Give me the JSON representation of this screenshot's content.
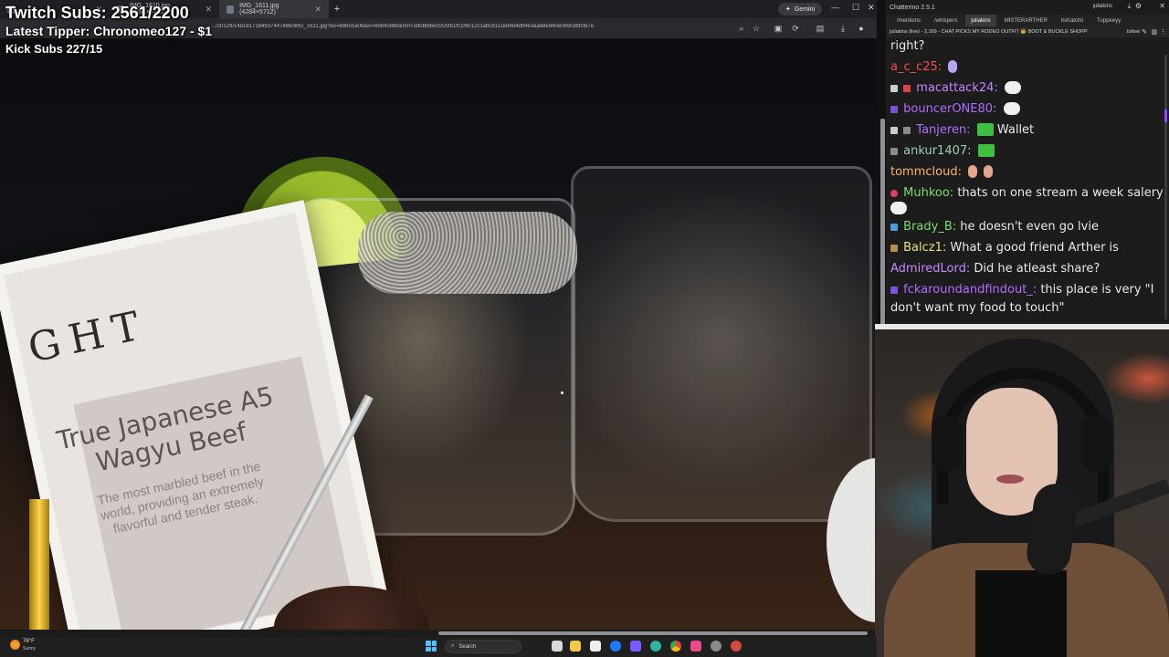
{
  "overlay": {
    "twitch_subs": "Twitch Subs: 2561/2200",
    "latest_tipper": "Latest Tipper: Chronomeo127 - $1",
    "kick_subs": "Kick Subs 227/15"
  },
  "browser": {
    "tabs": [
      {
        "label": "IMG_1610.jpg (4284×5712)",
        "active": false
      },
      {
        "label": "IMG_1611.jpg (4284×5712)",
        "active": true
      }
    ],
    "gemini_label": "Gemini",
    "url": "…/20129/1481817184937447486/IMG_1611.jpg?ex=69b55a0b&is=69b4088b&hm=3d0bfb6e0205fb1fc1f9012c1abc9111ed464dff4e3aab8e940e069cdbfcfb7e"
  },
  "photo": {
    "card_title": "GHT",
    "card_heading": "True Japanese A5 Wagyu Beef",
    "card_body": "The most marbled beef in the world, providing an extremely flavorful and tender steak."
  },
  "chat": {
    "app_title": "Chatterino 2.5.1",
    "user": "juliakins",
    "tabs": [
      "/mentions",
      "/whispers",
      "juliakins",
      "MISTERARTHER",
      "itsKatchii",
      "Tuppeeyy"
    ],
    "active_tab": "juliakins",
    "stream_header": "juliakins (live) - 2,169 - CHAT PICKS MY RODEO OUTFIT 🤠 BOOT & BUCKLE SHOPP",
    "follow_label": "follow",
    "messages": [
      {
        "user": "",
        "text": "right?",
        "color": "#e9e9e9"
      },
      {
        "user": "a_c_c25:",
        "text": "",
        "color": "#ff4a4a"
      },
      {
        "user": "macattack24:",
        "text": "",
        "color": "#c586ff"
      },
      {
        "user": "bouncerONE80:",
        "text": "",
        "color": "#b06cff"
      },
      {
        "user": "Tanjeren:",
        "text": "Wallet",
        "color": "#b06cff"
      },
      {
        "user": "ankur1407:",
        "text": "",
        "color": "#9ad0b0"
      },
      {
        "user": "tommcloud:",
        "text": "",
        "color": "#ffb26b"
      },
      {
        "user": "Muhkoo:",
        "text": "thats on one stream a week salery",
        "color": "#7cdb6f"
      },
      {
        "user": "Brady_B:",
        "text": "he doesn't even go lvie",
        "color": "#7cdb6f"
      },
      {
        "user": "Balcz1:",
        "text": "What a good friend Arther is",
        "color": "#e8e07a"
      },
      {
        "user": "AdmiredLord:",
        "text": "Did he atleast share?",
        "color": "#c586ff"
      },
      {
        "user": "fckaroundandfindout_:",
        "text": "this place is very \"I",
        "color": "#b06cff"
      },
      {
        "user": "",
        "text": "don't want my food to touch\"",
        "color": "#e9e9e9"
      }
    ]
  },
  "taskbar": {
    "weather_temp": "76°F",
    "weather_desc": "Sunny",
    "search_label": "Search"
  },
  "colors": {
    "accent": "#9146ff",
    "chat_bg": "#1c1c1c"
  }
}
